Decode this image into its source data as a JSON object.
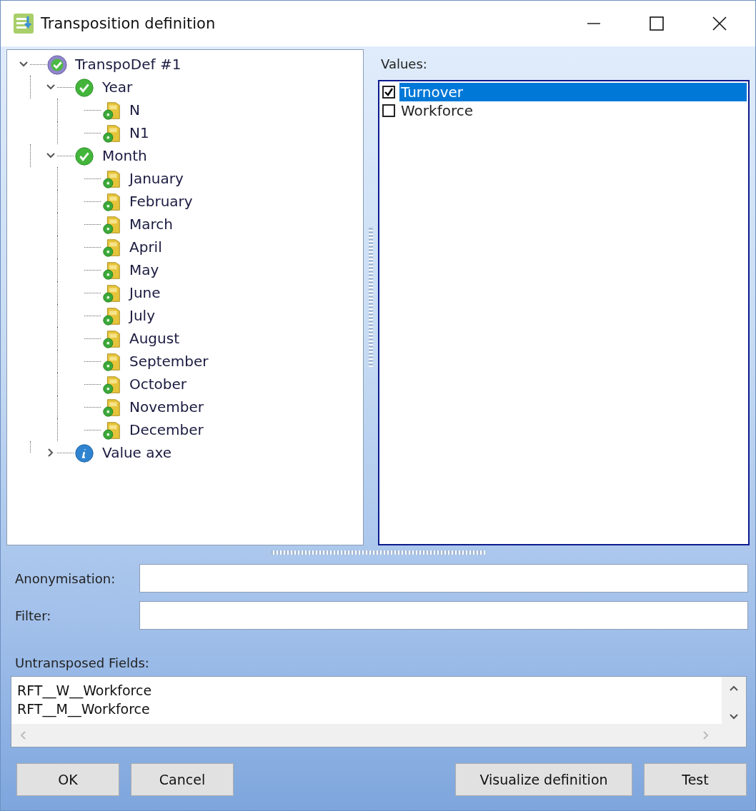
{
  "window": {
    "title": "Transposition definition"
  },
  "tree": [
    {
      "label": "TranspoDef #1",
      "kind": "root",
      "expanded": true,
      "children": [
        {
          "label": "Year",
          "kind": "group",
          "expanded": true,
          "children": [
            {
              "label": "N",
              "kind": "item"
            },
            {
              "label": "N1",
              "kind": "item"
            }
          ]
        },
        {
          "label": "Month",
          "kind": "group",
          "expanded": true,
          "children": [
            {
              "label": "January",
              "kind": "item"
            },
            {
              "label": "February",
              "kind": "item"
            },
            {
              "label": "March",
              "kind": "item"
            },
            {
              "label": "April",
              "kind": "item"
            },
            {
              "label": "May",
              "kind": "item"
            },
            {
              "label": "June",
              "kind": "item"
            },
            {
              "label": "July",
              "kind": "item"
            },
            {
              "label": "August",
              "kind": "item"
            },
            {
              "label": "September",
              "kind": "item"
            },
            {
              "label": "October",
              "kind": "item"
            },
            {
              "label": "November",
              "kind": "item"
            },
            {
              "label": "December",
              "kind": "item"
            }
          ]
        },
        {
          "label": "Value axe",
          "kind": "info",
          "expanded": false
        }
      ]
    }
  ],
  "values": {
    "label": "Values:",
    "items": [
      {
        "label": "Turnover",
        "checked": true,
        "selected": true
      },
      {
        "label": "Workforce",
        "checked": false,
        "selected": false
      }
    ]
  },
  "fields": [
    {
      "label": "Anonymisation:"
    },
    {
      "label": "Filter:"
    }
  ],
  "untransposed": {
    "label": "Untransposed Fields:",
    "lines": [
      "RFT__W__Workforce",
      "RFT__M__Workforce"
    ]
  },
  "buttons_left": [
    "OK",
    "Cancel"
  ],
  "buttons_right": [
    "Visualize definition",
    "Test"
  ]
}
